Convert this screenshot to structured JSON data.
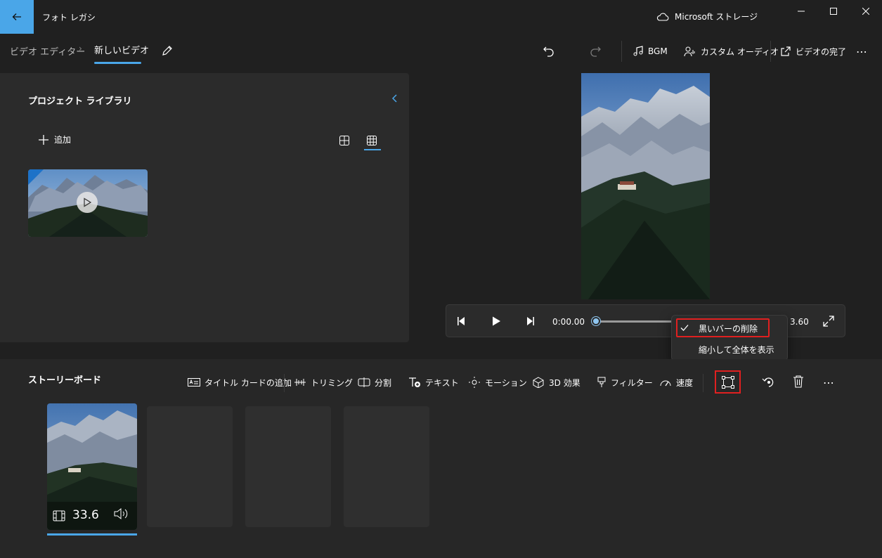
{
  "app": {
    "title": "フォト レガシ",
    "storage": "Microsoft ストレージ"
  },
  "breadcrumb": {
    "root": "ビデオ エディター",
    "separator": "›",
    "current": "新しいビデオ"
  },
  "toolbar": {
    "undo_icon": "undo-icon",
    "redo_icon": "redo-icon",
    "bgm": "BGM",
    "custom_audio": "カスタム オーディオ",
    "finish_video": "ビデオの完了",
    "more": "⋯"
  },
  "library": {
    "title": "プロジェクト ライブラリ",
    "add": "追加"
  },
  "player": {
    "current_time": "0:00.00",
    "total_time_visible": "3.60",
    "progress": 0
  },
  "dropdown": {
    "items": [
      {
        "label": "黒いバーの削除",
        "checked": true
      },
      {
        "label": "縮小して全体を表示",
        "checked": false
      }
    ]
  },
  "storyboard": {
    "title": "ストーリーボード",
    "tools": {
      "title_card": "タイトル カードの追加",
      "trim": "トリミング",
      "split": "分割",
      "text": "テキスト",
      "motion": "モーション",
      "effects3d": "3D 効果",
      "filter": "フィルター",
      "speed": "速度"
    },
    "clip": {
      "duration": "33.6"
    }
  },
  "colors": {
    "accent": "#4aa6e8",
    "highlight": "#e02020"
  }
}
